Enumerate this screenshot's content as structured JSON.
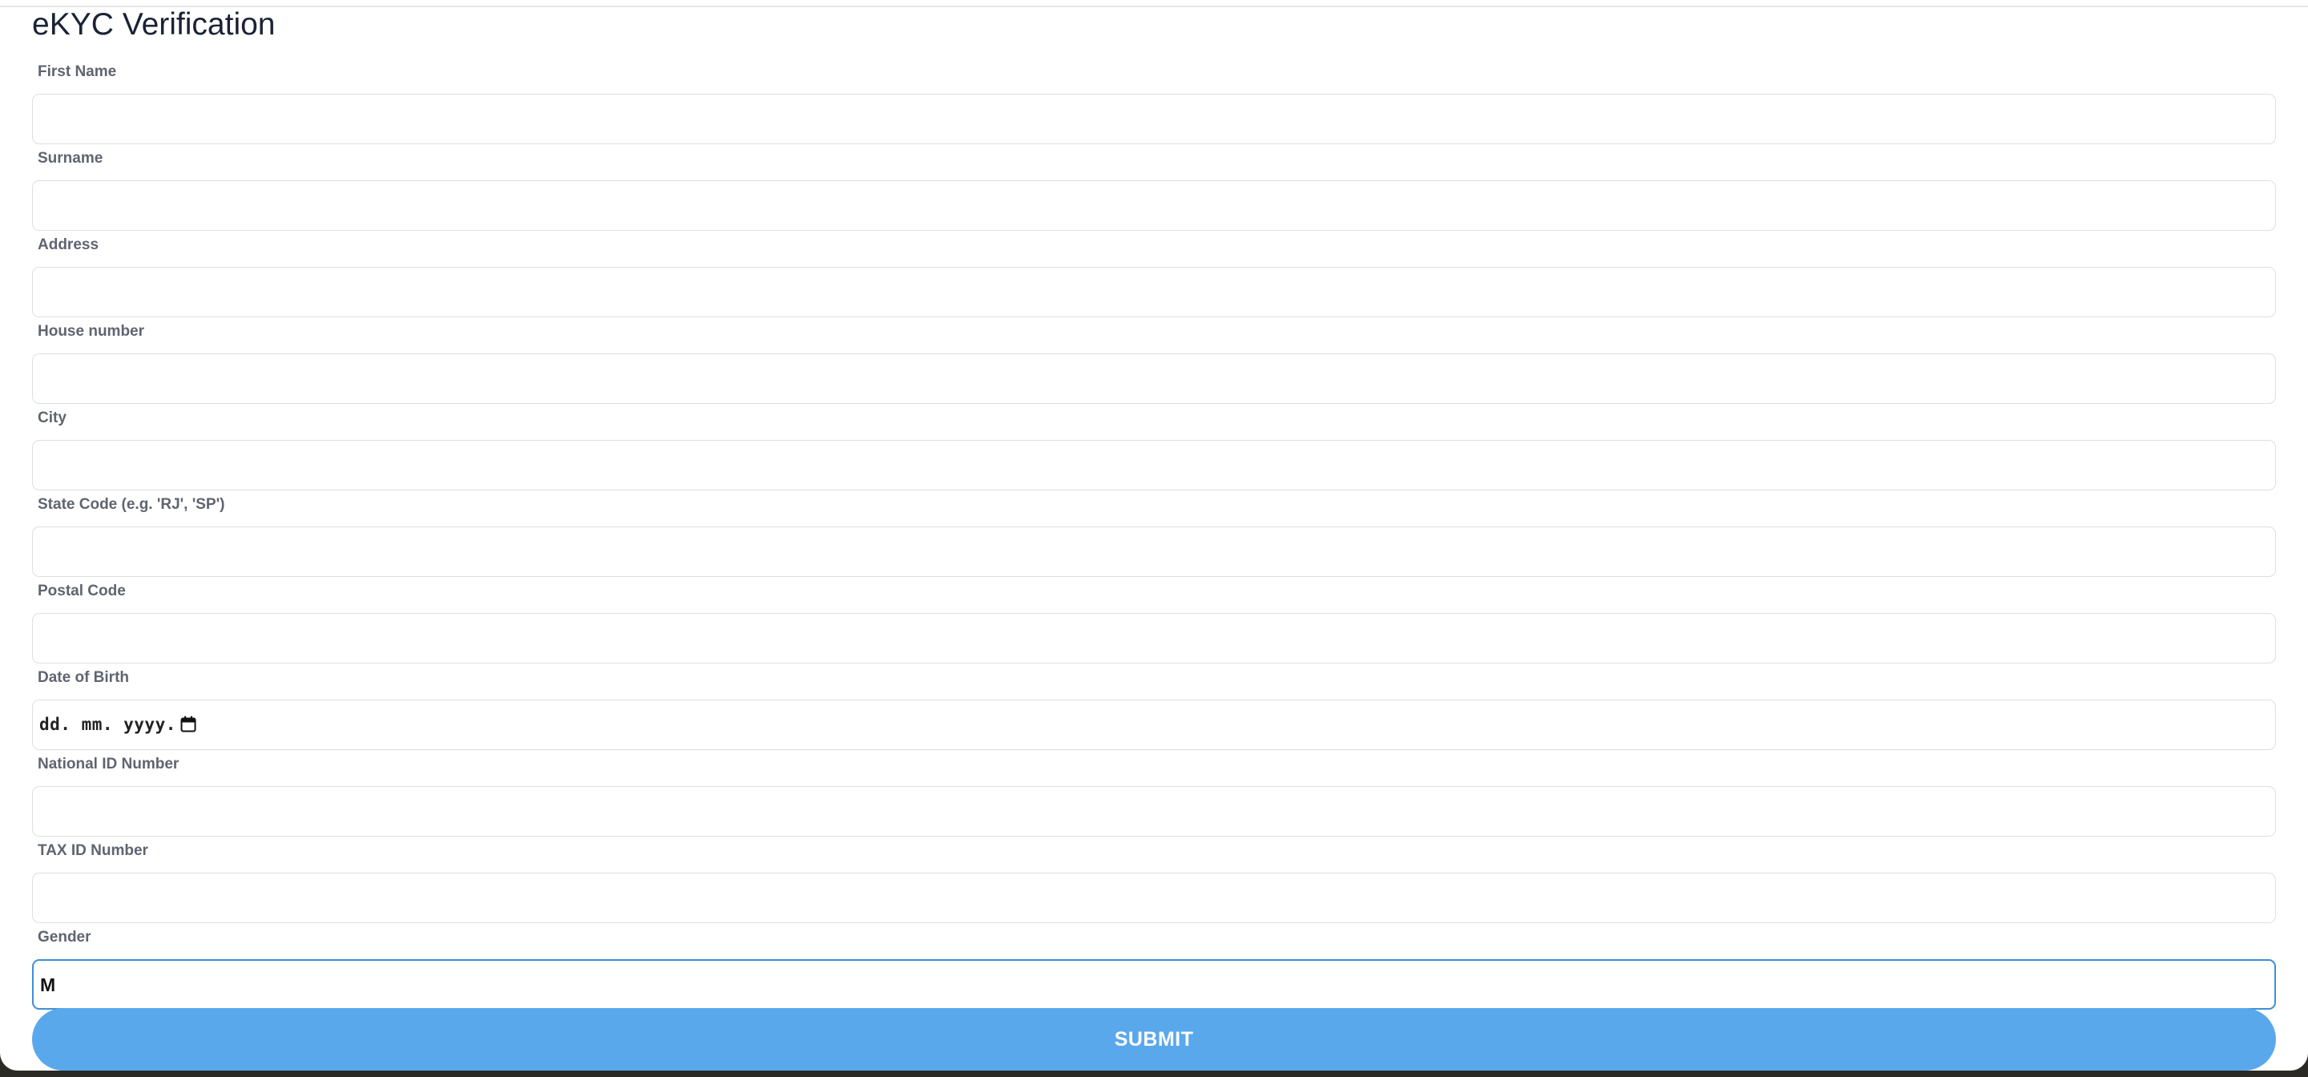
{
  "title": "eKYC Verification",
  "fields": [
    {
      "label": "First Name",
      "value": ""
    },
    {
      "label": "Surname",
      "value": ""
    },
    {
      "label": "Address",
      "value": ""
    },
    {
      "label": "House number",
      "value": ""
    },
    {
      "label": "City",
      "value": ""
    },
    {
      "label": "State Code (e.g. 'RJ', 'SP')",
      "value": ""
    },
    {
      "label": "Postal Code",
      "value": ""
    },
    {
      "label": "Date of Birth",
      "value": "",
      "placeholder": "dd. mm. yyyy."
    },
    {
      "label": "National ID Number",
      "value": ""
    },
    {
      "label": "TAX ID Number",
      "value": ""
    },
    {
      "label": "Gender",
      "value": "M"
    }
  ],
  "submit_label": "SUBMIT",
  "colors": {
    "accent": "#5aa8ec",
    "focus_border": "#3d8fd6",
    "title_text": "#1a2336",
    "label_text": "#5f6470"
  },
  "icons": {
    "date_picker": "calendar-icon"
  }
}
